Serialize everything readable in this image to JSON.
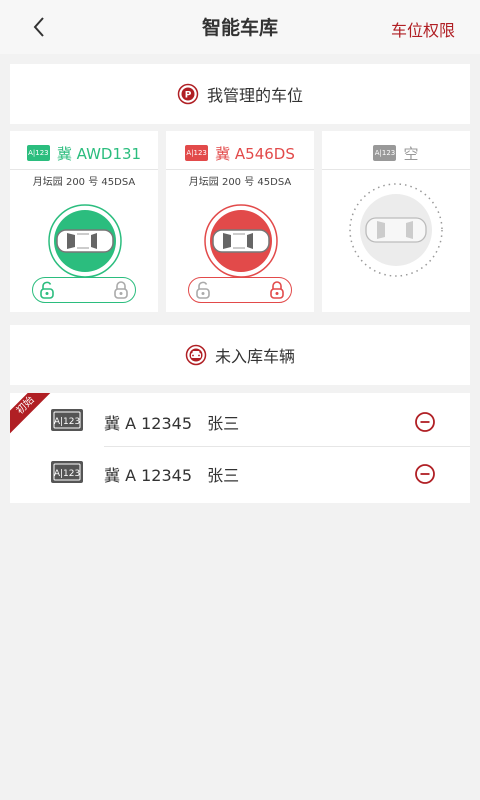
{
  "header": {
    "title": "智能车库",
    "right_link": "车位权限"
  },
  "managed_section": {
    "title": "我管理的车位"
  },
  "spaces": [
    {
      "plate": "冀 AWD131",
      "address": "月坛园 200 号  45DSA",
      "state": "unlocked",
      "color": "#2bbd7e"
    },
    {
      "plate": "冀 A546DS",
      "address": "月坛园 200 号  45DSA",
      "state": "locked",
      "color": "#e24a4a"
    },
    {
      "plate": "空",
      "state": "empty",
      "color": "#999999"
    }
  ],
  "plate_icon_text": "A|123",
  "unparked_section": {
    "title": "未入库车辆"
  },
  "vehicles": [
    {
      "plate": "冀 A 12345",
      "owner": "张三",
      "tag": "初始"
    },
    {
      "plate": "冀 A 12345",
      "owner": "张三"
    }
  ],
  "colors": {
    "accent": "#b01f24",
    "green": "#2bbd7e",
    "red": "#e24a4a"
  }
}
